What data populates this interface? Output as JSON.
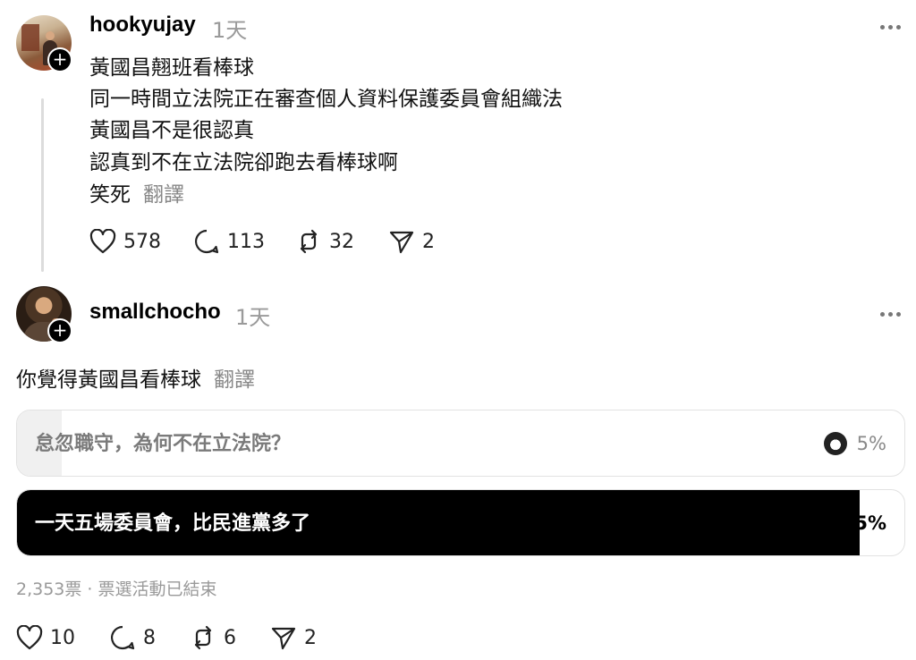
{
  "post1": {
    "username": "hookyujay",
    "time": "1天",
    "lines": [
      "黃國昌翹班看棒球",
      "同一時間立法院正在審查個人資料保護委員會組織法",
      "黃國昌不是很認真",
      "認真到不在立法院卻跑去看棒球啊",
      "笑死"
    ],
    "translate": "翻譯",
    "actions": {
      "likes": "578",
      "replies": "113",
      "reposts": "32",
      "shares": "2"
    }
  },
  "post2": {
    "username": "smallchocho",
    "time": "1天",
    "text": "你覺得黃國昌看棒球",
    "translate": "翻譯",
    "poll": {
      "options": [
        {
          "label": "怠忽職守，為何不在立法院？",
          "percent_text": "5%",
          "percent": 5,
          "selected": false
        },
        {
          "label": "一天五場委員會，比民進黨多了",
          "percent_text": "95%",
          "percent": 95,
          "selected": true
        }
      ],
      "meta": "2,353票 · 票選活動已結束"
    },
    "actions": {
      "likes": "10",
      "replies": "8",
      "reposts": "6",
      "shares": "2"
    }
  }
}
